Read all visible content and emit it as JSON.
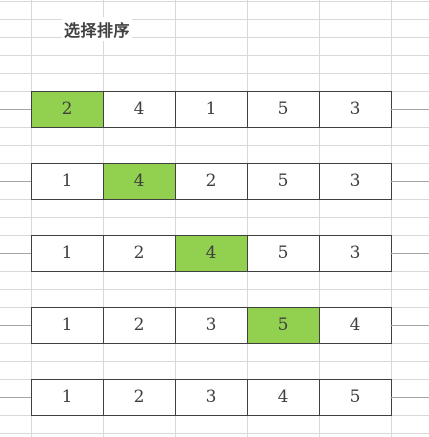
{
  "title": "选择排序",
  "highlight_color": "#92d050",
  "steps": [
    {
      "values": [
        "2",
        "4",
        "1",
        "5",
        "3"
      ],
      "highlight_index": 0
    },
    {
      "values": [
        "1",
        "4",
        "2",
        "5",
        "3"
      ],
      "highlight_index": 1
    },
    {
      "values": [
        "1",
        "2",
        "4",
        "5",
        "3"
      ],
      "highlight_index": 2
    },
    {
      "values": [
        "1",
        "2",
        "3",
        "5",
        "4"
      ],
      "highlight_index": 3
    },
    {
      "values": [
        "1",
        "2",
        "3",
        "4",
        "5"
      ],
      "highlight_index": -1
    }
  ]
}
